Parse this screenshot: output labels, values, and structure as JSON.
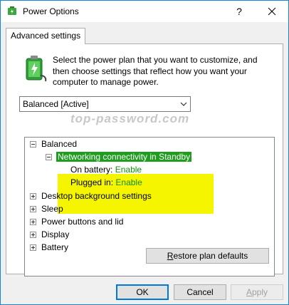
{
  "window": {
    "title": "Power Options"
  },
  "tabs": [
    {
      "label": "Advanced settings"
    }
  ],
  "intro_text": "Select the power plan that you want to customize, and then choose settings that reflect how you want your computer to manage power.",
  "plan_select": {
    "value": "Balanced [Active]"
  },
  "watermark": "top-password.com",
  "tree": {
    "root": "Balanced",
    "expanded_setting": "Networking connectivity in Standby",
    "on_battery_label": "On battery:",
    "on_battery_value": "Enable",
    "plugged_in_label": "Plugged in:",
    "plugged_in_value": "Enable",
    "collapsed_items": [
      "Desktop background settings",
      "Sleep",
      "Power buttons and lid",
      "Display",
      "Battery"
    ]
  },
  "buttons": {
    "restore_prefix": "",
    "restore_access": "R",
    "restore_rest": "estore plan defaults",
    "ok": "OK",
    "cancel": "Cancel",
    "apply_access": "A",
    "apply_rest": "pply"
  },
  "colors": {
    "highlight": "#f5f500",
    "selection": "#1e9d1e",
    "value_text": "#0f8f0f",
    "accent": "#0078d7"
  }
}
